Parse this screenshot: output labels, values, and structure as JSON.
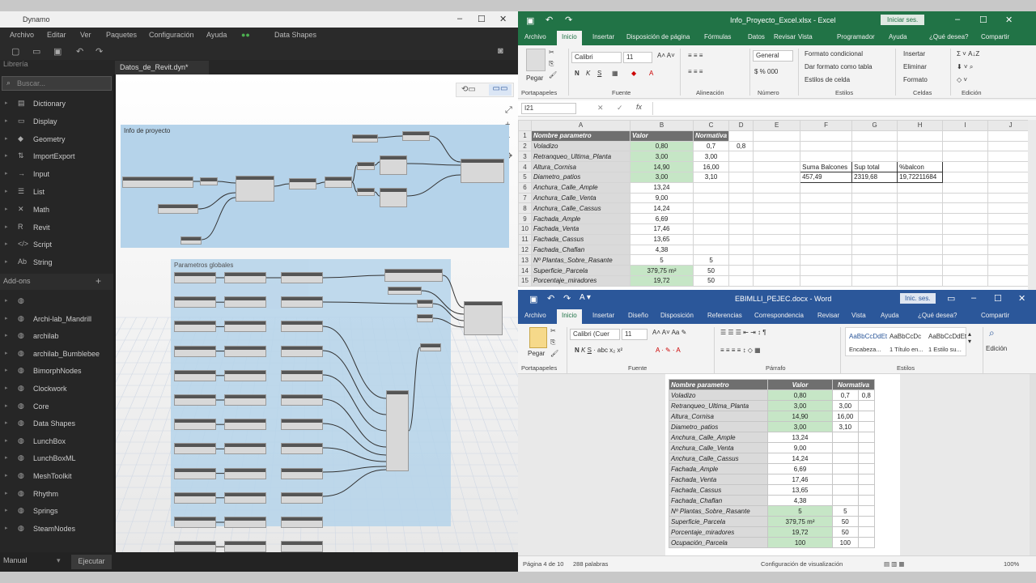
{
  "dynamo": {
    "menu": [
      "Archivo",
      "Editar",
      "Ver",
      "Paquetes",
      "Configuración",
      "Ayuda",
      "Data Shapes"
    ],
    "library_label": "Librería",
    "search_placeholder": "Buscar...",
    "library_items": [
      "Dictionary",
      "Display",
      "Geometry",
      "ImportExport",
      "Input",
      "List",
      "Math",
      "Revit",
      "Script",
      "String"
    ],
    "addons_label": "Add-ons",
    "addon_items": [
      "",
      "Archi-lab_Mandrill",
      "archilab",
      "archilab_Bumblebee",
      "BimorphNodes",
      "Clockwork",
      "Core",
      "Data Shapes",
      "LunchBox",
      "LunchBoxML",
      "MeshToolkit",
      "Rhythm",
      "Springs",
      "SteamNodes"
    ],
    "tab": "Datos_de_Revit.dyn*",
    "group1": "Info de proyecto",
    "group2": "Parametros globales",
    "run_mode": "Manual",
    "run_button": "Ejecutar"
  },
  "excel": {
    "title": "Info_Proyecto_Excel.xlsx - Excel",
    "signin": "Iniciar ses.",
    "tabs": [
      "Archivo",
      "Inicio",
      "Insertar",
      "Disposición de página",
      "Fórmulas",
      "Datos",
      "Revisar",
      "Vista",
      "Programador",
      "Ayuda",
      "¿Qué desea?",
      "Compartir"
    ],
    "active_tab": "Inicio",
    "font": "Calibri",
    "font_size": "11",
    "number_format": "General",
    "ribbon": {
      "pegar": "Pegar",
      "cond_format": "Formato condicional",
      "table_format": "Dar formato como tabla",
      "cell_styles": "Estilos de celda",
      "insert": "Insertar",
      "delete": "Eliminar",
      "format": "Formato",
      "groups": [
        "Portapapeles",
        "Fuente",
        "Alineación",
        "Número",
        "Estilos",
        "Celdas",
        "Edición"
      ]
    },
    "name_box": "I21",
    "columns": [
      "",
      "A",
      "B",
      "C",
      "D",
      "E",
      "F",
      "G",
      "H",
      "I",
      "J"
    ],
    "rows": [
      [
        "1",
        "Nombre parametro",
        "Valor",
        "Normativa",
        "",
        "",
        "",
        "",
        "",
        "",
        ""
      ],
      [
        "2",
        "Voladizo",
        "0,80",
        "0,7",
        "0,8",
        "",
        "",
        "",
        "",
        "",
        ""
      ],
      [
        "3",
        "Retranqueo_Ultima_Planta",
        "3,00",
        "3,00",
        "",
        "",
        "",
        "",
        "",
        "",
        ""
      ],
      [
        "4",
        "Altura_Cornisa",
        "14,90",
        "16,00",
        "",
        "",
        "Suma Balcones",
        "Sup total",
        "%balcon",
        "",
        ""
      ],
      [
        "5",
        "Diametro_patios",
        "3,00",
        "3,10",
        "",
        "",
        "457,49",
        "2319,68",
        "19,72211684",
        "",
        ""
      ],
      [
        "6",
        "Anchura_Calle_Ample",
        "13,24",
        "",
        "",
        "",
        "",
        "",
        "",
        "",
        ""
      ],
      [
        "7",
        "Anchura_Calle_Venta",
        "9,00",
        "",
        "",
        "",
        "",
        "",
        "",
        "",
        ""
      ],
      [
        "8",
        "Anchura_Calle_Cassus",
        "14,24",
        "",
        "",
        "",
        "",
        "",
        "",
        "",
        ""
      ],
      [
        "9",
        "Fachada_Ample",
        "6,69",
        "",
        "",
        "",
        "",
        "",
        "",
        "",
        ""
      ],
      [
        "10",
        "Fachada_Venta",
        "17,46",
        "",
        "",
        "",
        "",
        "",
        "",
        "",
        ""
      ],
      [
        "11",
        "Fachada_Cassus",
        "13,65",
        "",
        "",
        "",
        "",
        "",
        "",
        "",
        ""
      ],
      [
        "12",
        "Fachada_Chaflan",
        "4,38",
        "",
        "",
        "",
        "",
        "",
        "",
        "",
        ""
      ],
      [
        "13",
        "Nº Plantas_Sobre_Rasante",
        "5",
        "5",
        "",
        "",
        "",
        "",
        "",
        "",
        ""
      ],
      [
        "14",
        "Superficie_Parcela",
        "379,75 m²",
        "50",
        "",
        "",
        "",
        "",
        "",
        "",
        ""
      ],
      [
        "15",
        "Porcentaje_miradores",
        "19,72",
        "50",
        "",
        "",
        "",
        "",
        "",
        "",
        ""
      ]
    ]
  },
  "word": {
    "title": "EBIMLLI_PEJEC.docx - Word",
    "signin": "Inic. ses.",
    "tabs": [
      "Archivo",
      "Inicio",
      "Insertar",
      "Diseño",
      "Disposición",
      "Referencias",
      "Correspondencia",
      "Revisar",
      "Vista",
      "Ayuda",
      "¿Qué desea?",
      "Compartir"
    ],
    "active_tab": "Inicio",
    "font": "Calibri (Cuer",
    "font_size": "11",
    "paste": "Pegar",
    "styles": [
      "AaBbCcDdEt",
      "AaBbCcDc",
      "AaBbCcDdEt"
    ],
    "style_names": [
      "Encabeza...",
      "1 Título en...",
      "1 Estilo su..."
    ],
    "edit": "Edición",
    "groups": [
      "Portapapeles",
      "Fuente",
      "Párrafo",
      "Estilos"
    ],
    "table_header": [
      "Nombre parametro",
      "Valor",
      "Normativa"
    ],
    "table": [
      [
        "Voladizo",
        "0,80",
        "0,7",
        "0,8"
      ],
      [
        "Retranqueo_Ultima_Planta",
        "3,00",
        "3,00",
        ""
      ],
      [
        "Altura_Cornisa",
        "14,90",
        "16,00",
        ""
      ],
      [
        "Diametro_patios",
        "3,00",
        "3,10",
        ""
      ],
      [
        "Anchura_Calle_Ample",
        "13,24",
        "",
        ""
      ],
      [
        "Anchura_Calle_Venta",
        "9,00",
        "",
        ""
      ],
      [
        "Anchura_Calle_Cassus",
        "14,24",
        "",
        ""
      ],
      [
        "Fachada_Ample",
        "6,69",
        "",
        ""
      ],
      [
        "Fachada_Venta",
        "17,46",
        "",
        ""
      ],
      [
        "Fachada_Cassus",
        "13,65",
        "",
        ""
      ],
      [
        "Fachada_Chaflan",
        "4,38",
        "",
        ""
      ],
      [
        "Nº Plantas_Sobre_Rasante",
        "5",
        "5",
        ""
      ],
      [
        "Superficie_Parcela",
        "379,75 m²",
        "50",
        ""
      ],
      [
        "Porcentaje_miradores",
        "19,72",
        "50",
        ""
      ],
      [
        "Ocupación_Parcela",
        "100",
        "100",
        ""
      ]
    ],
    "status_page": "Página 4 de 10",
    "status_words": "288 palabras",
    "status_view": "Configuración de visualización",
    "zoom": "100%"
  },
  "colors": {
    "excel": "#217346",
    "word": "#2b579a",
    "green_cell": "#c6e6c6",
    "header_cell": "#6f6f6f"
  }
}
